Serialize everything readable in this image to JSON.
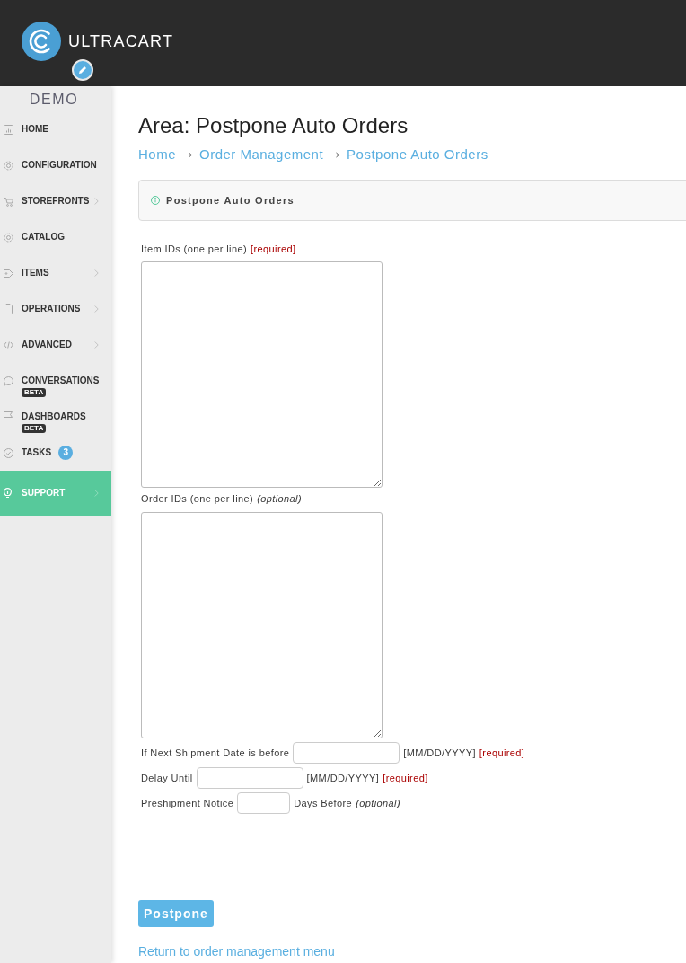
{
  "header": {
    "brand": "ULTRACART"
  },
  "sidebar": {
    "account": "DEMO",
    "items": [
      {
        "label": "HOME",
        "submenu": false,
        "selected": false
      },
      {
        "label": "CONFIGURATION",
        "submenu": false,
        "selected": false
      },
      {
        "label": "STOREFRONTS",
        "submenu": true,
        "selected": false
      },
      {
        "label": "CATALOG",
        "submenu": false,
        "selected": false
      },
      {
        "label": "ITEMS",
        "submenu": true,
        "selected": false
      },
      {
        "label": "OPERATIONS",
        "submenu": true,
        "selected": false
      },
      {
        "label": "ADVANCED",
        "submenu": true,
        "selected": false
      },
      {
        "label": "CONVERSATIONS",
        "submenu": false,
        "selected": false,
        "tag": "BETA"
      },
      {
        "label": "DASHBOARDS",
        "submenu": false,
        "selected": false,
        "tag": "BETA"
      },
      {
        "label": "TASKS",
        "submenu": false,
        "selected": false,
        "count": "3"
      },
      {
        "label": "SUPPORT",
        "submenu": true,
        "selected": true
      }
    ]
  },
  "page": {
    "title": "Area: Postpone Auto Orders",
    "breadcrumb": [
      "Home",
      "Order Management",
      "Postpone Auto Orders"
    ]
  },
  "panel": {
    "title": "Postpone Auto Orders"
  },
  "form": {
    "fields": [
      {
        "kind": "textarea",
        "label": "Item IDs (one per line)",
        "hint": "[required]",
        "required": true
      },
      {
        "kind": "textarea",
        "label": "Order IDs (one per line)",
        "hint": "(optional)",
        "required": false
      },
      {
        "kind": "date",
        "label": "If Next Shipment Date is before",
        "suffix": "[MM/DD/YYYY]",
        "hint": "[required]",
        "required": true
      },
      {
        "kind": "date",
        "label": "Delay Until",
        "suffix": "[MM/DD/YYYY]",
        "hint": "[required]",
        "required": true
      },
      {
        "kind": "number",
        "label": "Preshipment Notice",
        "suffix": "Days Before",
        "hint": "(optional)",
        "required": false
      }
    ]
  },
  "actions": {
    "button": "Postpone",
    "link": "Return to order management menu"
  }
}
